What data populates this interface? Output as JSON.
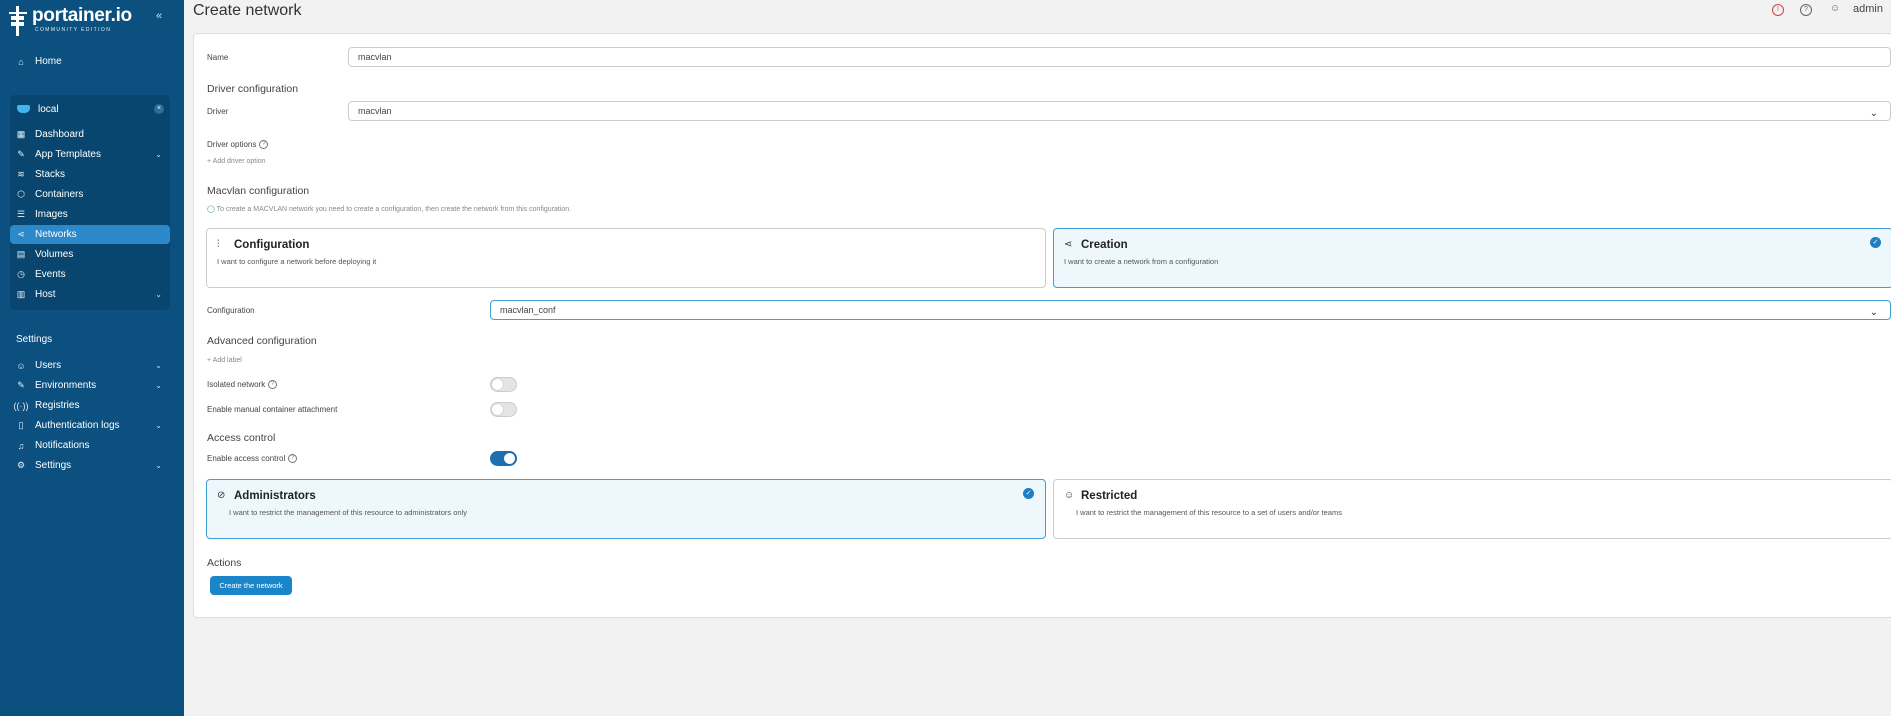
{
  "sidebar": {
    "logo_title": "portainer.io",
    "logo_subtitle": "COMMUNITY EDITION",
    "home": "Home",
    "environment": "local",
    "env_items": [
      "Dashboard",
      "App Templates",
      "Stacks",
      "Containers",
      "Images",
      "Networks",
      "Volumes",
      "Events",
      "Host"
    ],
    "settings_heading": "Settings",
    "settings_items": [
      "Users",
      "Environments",
      "Registries",
      "Authentication logs",
      "Notifications",
      "Settings"
    ]
  },
  "header": {
    "title": "Create network",
    "user": "admin"
  },
  "form": {
    "name_label": "Name",
    "name_value": "macvlan",
    "driver_config_heading": "Driver configuration",
    "driver_label": "Driver",
    "driver_value": "macvlan",
    "driver_options_label": "Driver options",
    "add_driver_option": "Add driver option",
    "macvlan_heading": "Macvlan configuration",
    "macvlan_info": "To create a MACVLAN network you need to create a configuration, then create the network from this configuration.",
    "config_card_title": "Configuration",
    "config_card_desc": "I want to configure a network before deploying it",
    "creation_card_title": "Creation",
    "creation_card_desc": "I want to create a network from a configuration",
    "configuration_label": "Configuration",
    "configuration_value": "macvlan_conf",
    "advanced_heading": "Advanced configuration",
    "add_label": "Add label",
    "isolated_label": "Isolated network",
    "manual_attach_label": "Enable manual container attachment",
    "access_heading": "Access control",
    "enable_access_label": "Enable access control",
    "admin_card_title": "Administrators",
    "admin_card_desc": "I want to restrict the management of this resource to administrators only",
    "restricted_card_title": "Restricted",
    "restricted_card_desc": "I want to restrict the management of this resource to a set of users and/or teams",
    "actions_heading": "Actions",
    "create_button": "Create the network"
  },
  "state": {
    "isolated_network": false,
    "manual_attachment": false,
    "access_control": true,
    "selected_macvlan_mode": "Creation",
    "selected_access": "Administrators",
    "active_nav": "Networks"
  },
  "colors": {
    "sidebar_bg": "#0c5080",
    "accent": "#1b85c9"
  }
}
